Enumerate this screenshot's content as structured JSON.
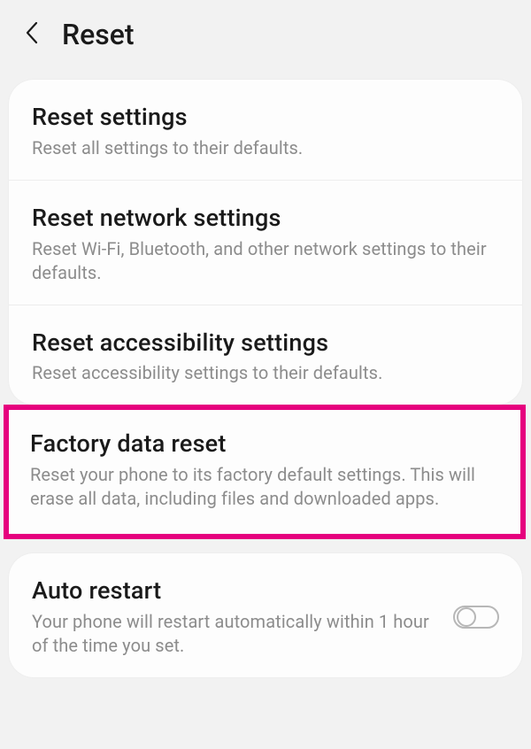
{
  "header": {
    "title": "Reset"
  },
  "items": {
    "reset_settings": {
      "title": "Reset settings",
      "desc": "Reset all settings to their defaults."
    },
    "reset_network": {
      "title": "Reset network settings",
      "desc": "Reset Wi-Fi, Bluetooth, and other network settings to their defaults."
    },
    "reset_accessibility": {
      "title": "Reset accessibility settings",
      "desc": "Reset accessibility settings to their defaults."
    },
    "factory_reset": {
      "title": "Factory data reset",
      "desc": "Reset your phone to its factory default settings. This will erase all data, including files and downloaded apps."
    },
    "auto_restart": {
      "title": "Auto restart",
      "desc": "Your phone will restart automatically within 1 hour of the time you set.",
      "toggle_on": false
    }
  }
}
